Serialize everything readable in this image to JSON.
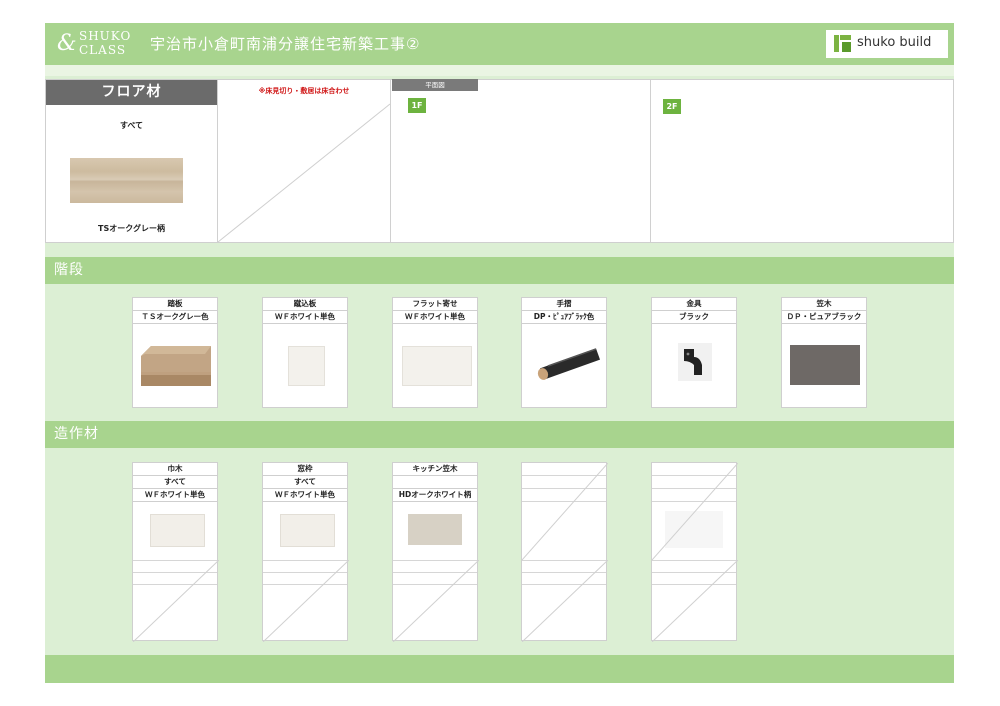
{
  "header": {
    "brand_line1": "SHUKO",
    "brand_line2": "CLASS",
    "title": "宇治市小倉町南浦分譲住宅新築工事②",
    "logo_text": "shuko build",
    "accent_color": "#a8d48e"
  },
  "floor": {
    "heading": "フロア材",
    "scope": "すべて",
    "material": "TSオークグレー柄",
    "note": "※床見切り・敷居は床合わせ",
    "plan_tab": "平面図",
    "floor1": "1F",
    "floor2": "2F"
  },
  "stairs": {
    "section_title": "階段",
    "items": [
      {
        "part": "踏板",
        "material": "ＴＳオークグレー色",
        "swatch_color": "#b89a78"
      },
      {
        "part": "蹴込板",
        "material": "ＷＦホワイト単色",
        "swatch_color": "#f3f1ec"
      },
      {
        "part": "フラット寄せ",
        "material": "ＷＦホワイト単色",
        "swatch_color": "#f3f1ec"
      },
      {
        "part": "手摺",
        "material": "DP・ﾋﾟｭｱﾌﾞﾗｯｸ色",
        "swatch_color": "#2a2a2a"
      },
      {
        "part": "金具",
        "material": "ブラック",
        "swatch_color": "#222222"
      },
      {
        "part": "笠木",
        "material": "ＤＰ・ピュアブラック",
        "swatch_color": "#6e6966"
      }
    ]
  },
  "millwork": {
    "section_title": "造作材",
    "items": [
      {
        "part": "巾木",
        "scope": "すべて",
        "material": "ＷＦホワイト単色",
        "swatch_color": "#f2efe9"
      },
      {
        "part": "窓枠",
        "scope": "すべて",
        "material": "ＷＦホワイト単色",
        "swatch_color": "#f2efe9"
      },
      {
        "part": "キッチン笠木",
        "scope": "",
        "material": "HDオークホワイト柄",
        "swatch_color": "#d7d1c5"
      },
      {
        "part": "",
        "scope": "",
        "material": "",
        "swatch_color": ""
      },
      {
        "part": "",
        "scope": "",
        "material": "",
        "swatch_color": "#f6f6f6"
      }
    ]
  }
}
